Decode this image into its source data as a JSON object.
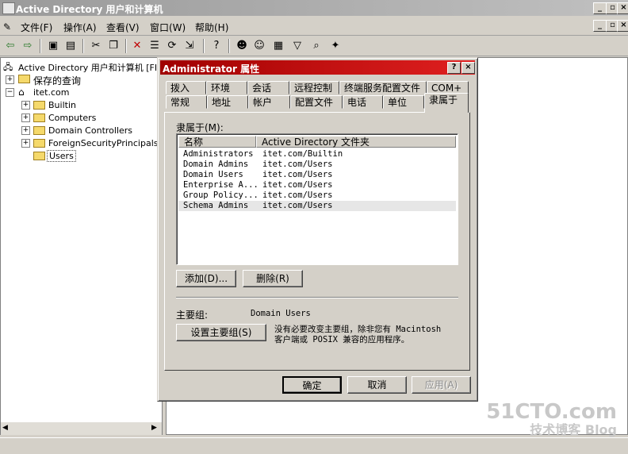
{
  "window": {
    "title": "Active Directory 用户和计算机"
  },
  "menu": [
    "文件(F)",
    "操作(A)",
    "查看(V)",
    "窗口(W)",
    "帮助(H)"
  ],
  "tree": {
    "root": "Active Directory 用户和计算机 [FIR",
    "saved_queries": "保存的查询",
    "domain": "itet.com",
    "children": [
      "Builtin",
      "Computers",
      "Domain Controllers",
      "ForeignSecurityPrincipals",
      "Users"
    ]
  },
  "dialog": {
    "title": "Administrator 属性",
    "help_btn": "?",
    "close_btn": "×",
    "tabs_row1": [
      "拨入",
      "环境",
      "会话",
      "远程控制",
      "终端服务配置文件",
      "COM+"
    ],
    "tabs_row2": [
      "常规",
      "地址",
      "帐户",
      "配置文件",
      "电话",
      "单位",
      "隶属于"
    ],
    "member_of_label": "隶属于(M):",
    "columns": [
      "名称",
      "Active Directory 文件夹"
    ],
    "rows": [
      [
        "Administrators",
        "itet.com/Builtin"
      ],
      [
        "Domain Admins",
        "itet.com/Users"
      ],
      [
        "Domain Users",
        "itet.com/Users"
      ],
      [
        "Enterprise A...",
        "itet.com/Users"
      ],
      [
        "Group Policy...",
        "itet.com/Users"
      ],
      [
        "Schema Admins",
        "itet.com/Users"
      ]
    ],
    "add_btn": "添加(D)...",
    "remove_btn": "删除(R)",
    "primary_group_label": "主要组:",
    "primary_group_value": "Domain Users",
    "set_primary_btn": "设置主要组(S)",
    "note_line1": "没有必要改变主要组，除非您有 Macintosh",
    "note_line2": "客户端或 POSIX 兼容的应用程序。",
    "ok_btn": "确定",
    "cancel_btn": "取消",
    "apply_btn": "应用(A)"
  },
  "watermark": {
    "line1": "51CTO.com",
    "line2": "技术博客 Blog"
  }
}
